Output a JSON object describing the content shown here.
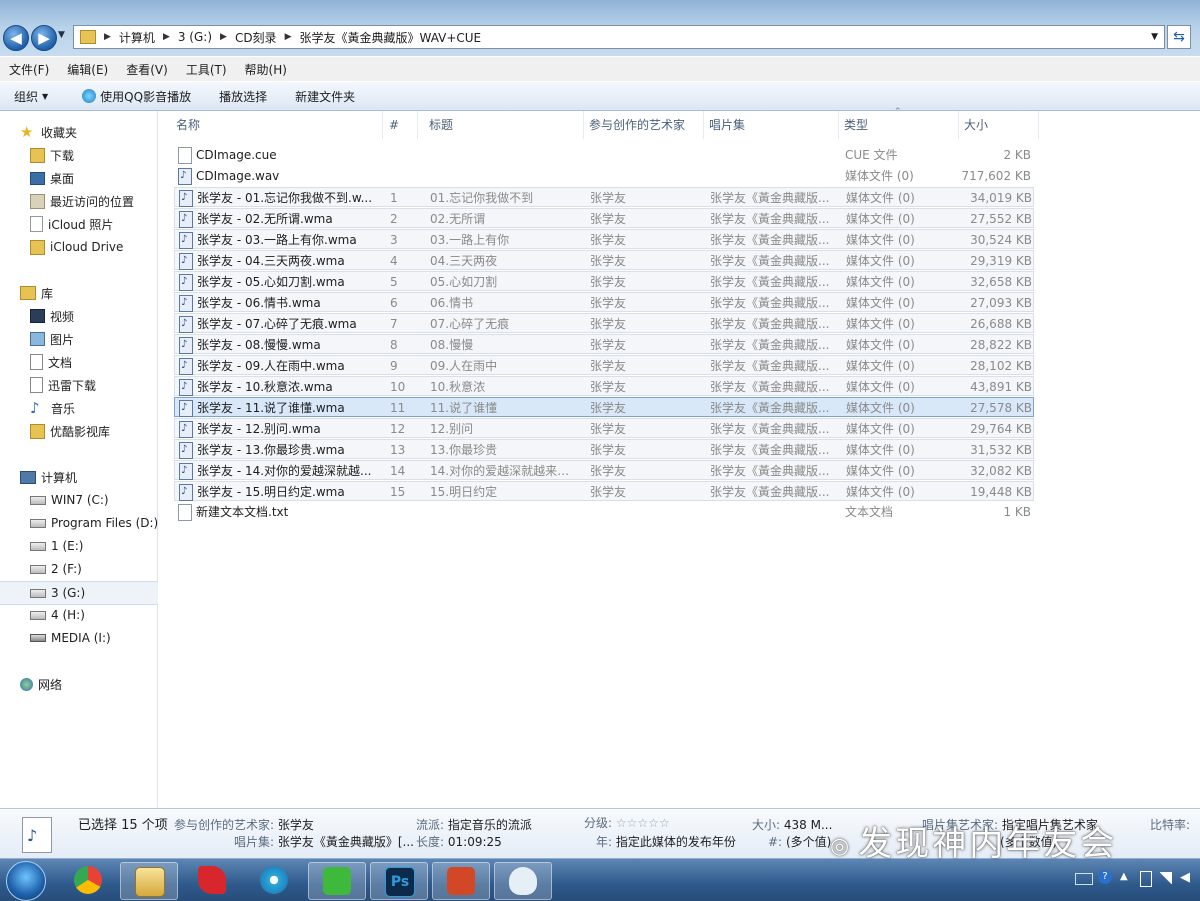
{
  "address": {
    "crumbs": [
      "计算机",
      "3 (G:)",
      "CD刻录",
      "张学友《黃金典藏版》WAV+CUE"
    ]
  },
  "menubar": [
    "文件(F)",
    "编辑(E)",
    "查看(V)",
    "工具(T)",
    "帮助(H)"
  ],
  "toolbar": {
    "organize": "组织",
    "play_qq": "使用QQ影音播放",
    "play_selected": "播放选择",
    "new_folder": "新建文件夹"
  },
  "nav": {
    "favorites": {
      "header": "收藏夹",
      "items": [
        "下载",
        "桌面",
        "最近访问的位置",
        "iCloud 照片",
        "iCloud Drive"
      ]
    },
    "library": {
      "header": "库",
      "items": [
        "视频",
        "图片",
        "文档",
        "迅雷下载",
        "音乐",
        "优酷影视库"
      ]
    },
    "computer": {
      "header": "计算机",
      "items": [
        "WIN7 (C:)",
        "Program Files (D:)",
        "1 (E:)",
        "2 (F:)",
        "3 (G:)",
        "4 (H:)",
        "MEDIA (I:)"
      ]
    },
    "network": {
      "header": "网络"
    }
  },
  "columns": {
    "name": "名称",
    "num": "#",
    "title": "标题",
    "artist": "参与创作的艺术家",
    "album": "唱片集",
    "type": "类型",
    "size": "大小"
  },
  "files": [
    {
      "name": "CDImage.cue",
      "num": "",
      "title": "",
      "artist": "",
      "album": "",
      "type": "CUE 文件",
      "size": "2 KB"
    },
    {
      "name": "CDImage.wav",
      "num": "",
      "title": "",
      "artist": "",
      "album": "",
      "type": "媒体文件 (0)",
      "size": "717,602 KB"
    },
    {
      "name": "张学友 - 01.忘记你我做不到.w...",
      "num": "1",
      "title": "01.忘记你我做不到",
      "artist": "张学友",
      "album": "张学友《黃金典藏版...",
      "type": "媒体文件 (0)",
      "size": "34,019 KB"
    },
    {
      "name": "张学友 - 02.无所谓.wma",
      "num": "2",
      "title": "02.无所谓",
      "artist": "张学友",
      "album": "张学友《黃金典藏版...",
      "type": "媒体文件 (0)",
      "size": "27,552 KB"
    },
    {
      "name": "张学友 - 03.一路上有你.wma",
      "num": "3",
      "title": "03.一路上有你",
      "artist": "张学友",
      "album": "张学友《黃金典藏版...",
      "type": "媒体文件 (0)",
      "size": "30,524 KB"
    },
    {
      "name": "张学友 - 04.三天两夜.wma",
      "num": "4",
      "title": "04.三天两夜",
      "artist": "张学友",
      "album": "张学友《黃金典藏版...",
      "type": "媒体文件 (0)",
      "size": "29,319 KB"
    },
    {
      "name": "张学友 - 05.心如刀割.wma",
      "num": "5",
      "title": "05.心如刀割",
      "artist": "张学友",
      "album": "张学友《黃金典藏版...",
      "type": "媒体文件 (0)",
      "size": "32,658 KB"
    },
    {
      "name": "张学友 - 06.情书.wma",
      "num": "6",
      "title": "06.情书",
      "artist": "张学友",
      "album": "张学友《黃金典藏版...",
      "type": "媒体文件 (0)",
      "size": "27,093 KB"
    },
    {
      "name": "张学友 - 07.心碎了无痕.wma",
      "num": "7",
      "title": "07.心碎了无痕",
      "artist": "张学友",
      "album": "张学友《黃金典藏版...",
      "type": "媒体文件 (0)",
      "size": "26,688 KB"
    },
    {
      "name": "张学友 - 08.慢慢.wma",
      "num": "8",
      "title": "08.慢慢",
      "artist": "张学友",
      "album": "张学友《黃金典藏版...",
      "type": "媒体文件 (0)",
      "size": "28,822 KB"
    },
    {
      "name": "张学友 - 09.人在雨中.wma",
      "num": "9",
      "title": "09.人在雨中",
      "artist": "张学友",
      "album": "张学友《黃金典藏版...",
      "type": "媒体文件 (0)",
      "size": "28,102 KB"
    },
    {
      "name": "张学友 - 10.秋意浓.wma",
      "num": "10",
      "title": "10.秋意浓",
      "artist": "张学友",
      "album": "张学友《黃金典藏版...",
      "type": "媒体文件 (0)",
      "size": "43,891 KB"
    },
    {
      "name": "张学友 - 11.说了谁懂.wma",
      "num": "11",
      "title": "11.说了谁懂",
      "artist": "张学友",
      "album": "张学友《黃金典藏版...",
      "type": "媒体文件 (0)",
      "size": "27,578 KB"
    },
    {
      "name": "张学友 - 12.别问.wma",
      "num": "12",
      "title": "12.别问",
      "artist": "张学友",
      "album": "张学友《黃金典藏版...",
      "type": "媒体文件 (0)",
      "size": "29,764 KB"
    },
    {
      "name": "张学友 - 13.你最珍贵.wma",
      "num": "13",
      "title": "13.你最珍贵",
      "artist": "张学友",
      "album": "张学友《黃金典藏版...",
      "type": "媒体文件 (0)",
      "size": "31,532 KB"
    },
    {
      "name": "张学友 - 14.对你的爱越深就越...",
      "num": "14",
      "title": "14.对你的爱越深就越来越...",
      "artist": "张学友",
      "album": "张学友《黃金典藏版...",
      "type": "媒体文件 (0)",
      "size": "32,082 KB"
    },
    {
      "name": "张学友 - 15.明日约定.wma",
      "num": "15",
      "title": "15.明日约定",
      "artist": "张学友",
      "album": "张学友《黃金典藏版...",
      "type": "媒体文件 (0)",
      "size": "19,448 KB"
    },
    {
      "name": "新建文本文档.txt",
      "num": "",
      "title": "",
      "artist": "",
      "album": "",
      "type": "文本文档",
      "size": "1 KB"
    }
  ],
  "details": {
    "selected": "已选择 15 个项",
    "artist_label": "参与创作的艺术家:",
    "artist_value": "张学友",
    "genre_label": "流派:",
    "genre_value": "指定音乐的流派",
    "rating_label": "分级:",
    "size_label": "大小:",
    "size_value": "438 M...",
    "album_artist_label": "唱片集艺术家:",
    "album_artist_value": "指定唱片集艺术家",
    "bitrate_label": "比特率:",
    "album_label": "唱片集:",
    "album_value": "张学友《黃金典藏版》[...",
    "length_label": "长度:",
    "length_value": "01:09:25",
    "year_label": "年:",
    "year_value": "指定此媒体的发布年份",
    "track_label": "#:",
    "track_value": "(多个值)",
    "extra_value": "(多个数值)"
  },
  "watermark": "发现神内年友会",
  "colors": {
    "selection": "#d8e8f9",
    "accent": "#1f5fa8"
  }
}
